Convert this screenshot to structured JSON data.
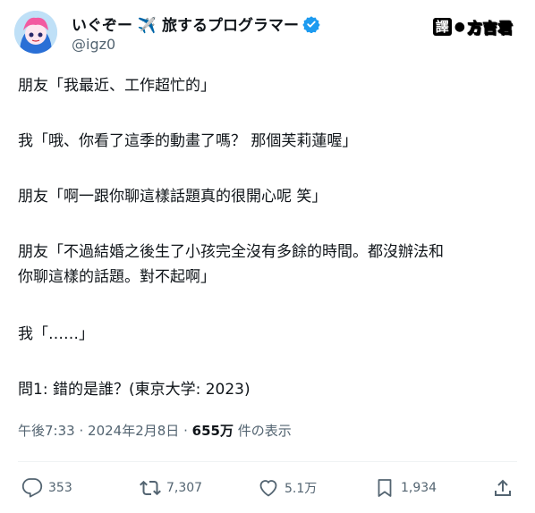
{
  "author": {
    "display_name": "いぐぞー ✈️ 旅するプログラマー",
    "handle": "@igz0"
  },
  "translator_badge": {
    "label_char": "譯",
    "name": "方吉君"
  },
  "tweet": {
    "lines": [
      "朋友「我最近、工作超忙的」",
      "我「哦、你看了這季的動畫了嗎？ 那個芙莉蓮喔」",
      "朋友「啊一跟你聊這樣話題真的很開心呢 笑」",
      "朋友「不過結婚之後生了小孩完全沒有多餘的時間。都沒辦法和",
      "你聊這樣的話題。對不起啊」",
      "我「……」",
      "問1: 錯的是誰？(東京大学: 2023)"
    ]
  },
  "meta": {
    "time": "午後7:33",
    "separator": "·",
    "date": "2024年2月8日",
    "views_count": "655万",
    "views_label": "件の表示"
  },
  "actions": {
    "replies": "353",
    "retweets": "7,307",
    "likes": "5.1万",
    "bookmarks": "1,934"
  },
  "colors": {
    "text": "#0f1419",
    "secondary": "#536471",
    "verified": "#1d9bf0",
    "divider": "#eff3f4"
  }
}
